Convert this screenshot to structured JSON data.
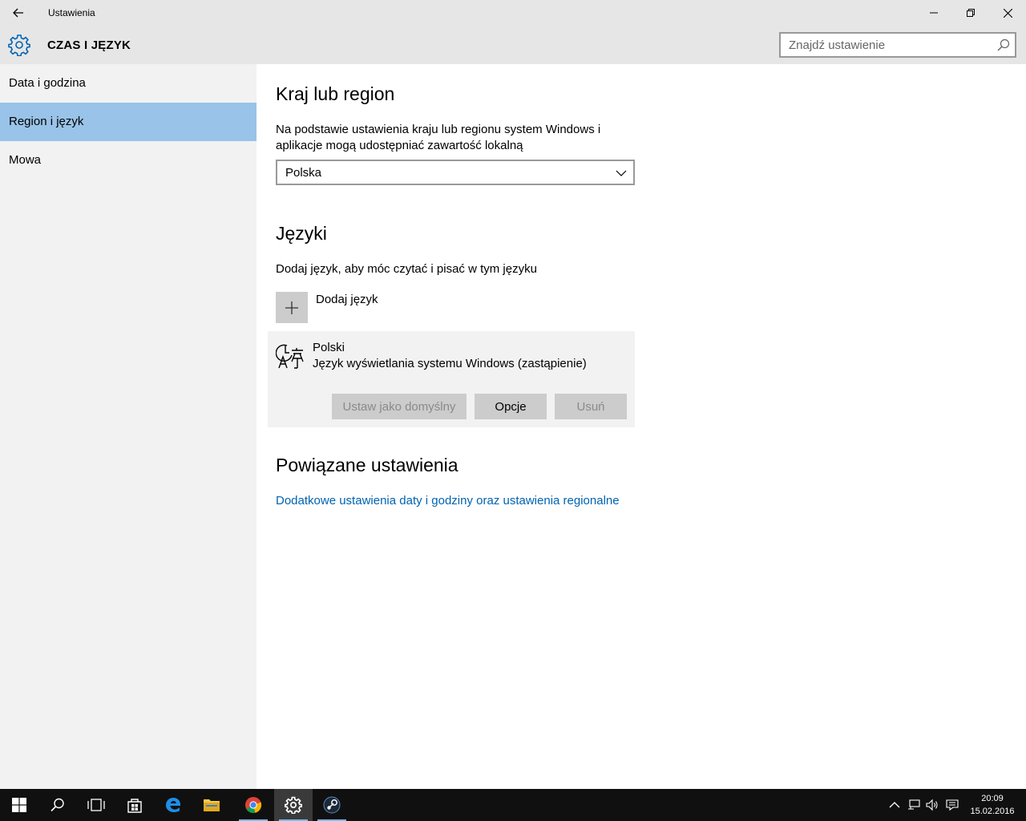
{
  "window": {
    "title": "Ustawienia"
  },
  "header": {
    "section_title": "CZAS I JĘZYK",
    "search_placeholder": "Znajdź ustawienie"
  },
  "sidebar": {
    "items": [
      {
        "label": "Data i godzina",
        "active": false
      },
      {
        "label": "Region i język",
        "active": true
      },
      {
        "label": "Mowa",
        "active": false
      }
    ]
  },
  "region": {
    "heading": "Kraj lub region",
    "description": "Na podstawie ustawienia kraju lub regionu system Windows i aplikacje mogą udostępniać zawartość lokalną",
    "selected_country": "Polska"
  },
  "languages": {
    "heading": "Języki",
    "description": "Dodaj język, aby móc czytać i pisać w tym języku",
    "add_label": "Dodaj język",
    "items": [
      {
        "name": "Polski",
        "detail": "Język wyświetlania systemu Windows (zastąpienie)",
        "buttons": {
          "set_default": "Ustaw jako domyślny",
          "options": "Opcje",
          "remove": "Usuń"
        }
      }
    ]
  },
  "related": {
    "heading": "Powiązane ustawienia",
    "link": "Dodatkowe ustawienia daty i godziny oraz ustawienia regionalne"
  },
  "taskbar": {
    "apps": [
      "start-icon",
      "search-icon",
      "task-view-icon",
      "store-icon",
      "edge-icon",
      "file-explorer-icon",
      "chrome-icon",
      "settings-icon",
      "steam-icon"
    ],
    "time": "20:09",
    "date": "15.02.2016"
  },
  "colors": {
    "accent": "#0063b1",
    "sidebar_active": "#99c3e8",
    "chrome": "#e6e6e6"
  }
}
